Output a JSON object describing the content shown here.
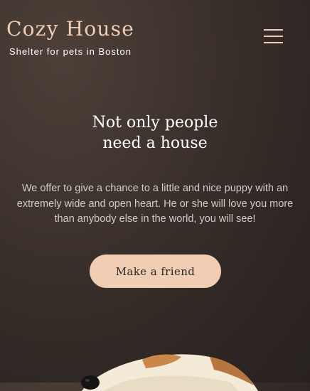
{
  "header": {
    "logo_title": "Cozy House",
    "logo_subtitle": "Shelter for pets in Boston",
    "menu_icon": "burger-menu-icon"
  },
  "hero": {
    "title_line1": "Not only people",
    "title_line2": "need a house",
    "text": "We offer to give a chance to a little and nice puppy with an extremely wide and open heart. He or she will love you more than anybody else in the world, you will see!",
    "button_label": "Make a friend"
  },
  "colors": {
    "accent": "#f1cdb3",
    "background": "#3a302b",
    "text_light": "#cdcdcd",
    "title": "#ffffff"
  }
}
